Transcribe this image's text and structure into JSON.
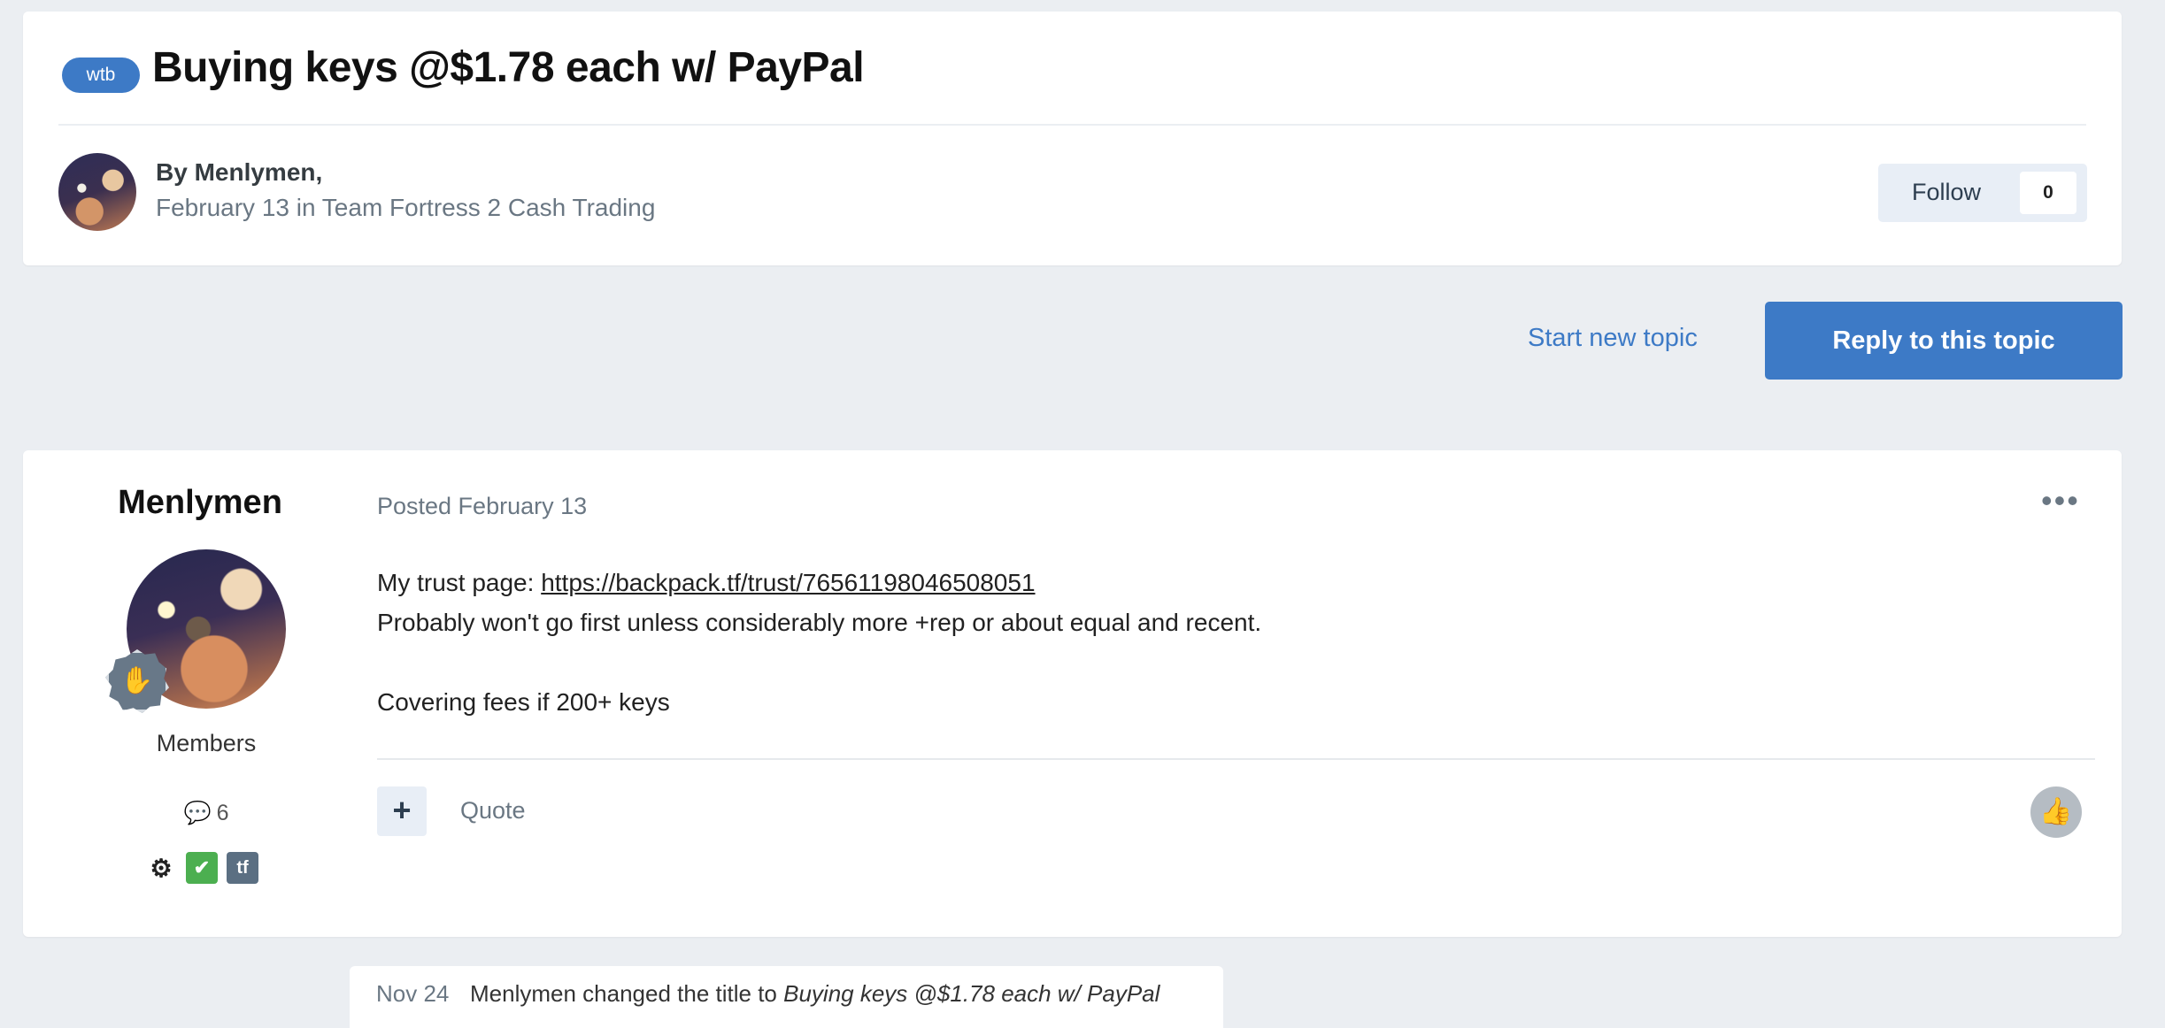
{
  "topic": {
    "tag": "wtb",
    "title": "Buying keys @$1.78 each w/ PayPal",
    "author_line": "By Menlymen,",
    "meta_line": "February 13 in Team Fortress 2 Cash Trading",
    "follow_label": "Follow",
    "follow_count": "0"
  },
  "actions": {
    "start_topic": "Start new topic",
    "reply": "Reply to this topic"
  },
  "post": {
    "author": "Menlymen",
    "group": "Members",
    "post_count": "6",
    "posted": "Posted February 13",
    "options_label": "•••",
    "body_intro": "My trust page: ",
    "trust_link": "https://backpack.tf/trust/76561198046508051",
    "body_line2": "Probably won't go first unless considerably more +rep or about equal and recent.",
    "body_line3": "Covering fees if 200+ keys",
    "quote_label": "Quote",
    "badges": [
      "steam-icon",
      "check-icon",
      "tf-icon"
    ]
  },
  "event": {
    "date": "Nov 24",
    "text": "Menlymen changed the title to ",
    "new_title": "Buying keys @$1.78 each w/ PayPal"
  }
}
